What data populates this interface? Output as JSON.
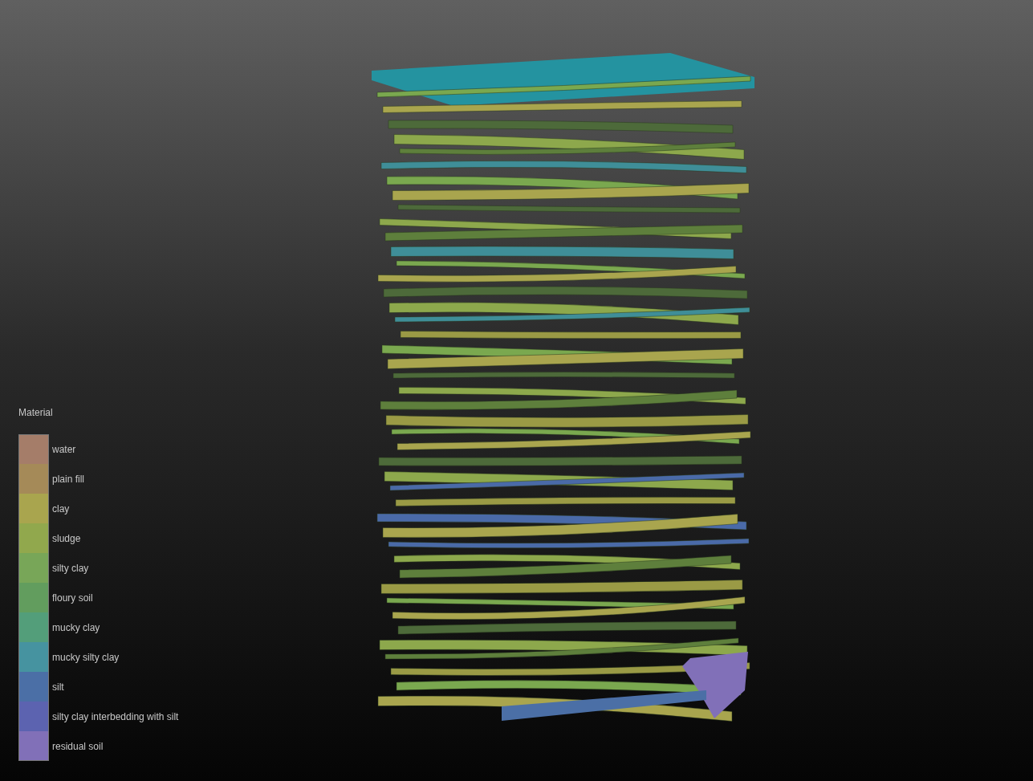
{
  "legend": {
    "title": "Material",
    "items": [
      {
        "label": "water",
        "color": "#a57d69"
      },
      {
        "label": "plain fill",
        "color": "#a58a58"
      },
      {
        "label": "clay",
        "color": "#a9a54e"
      },
      {
        "label": "sludge",
        "color": "#91a84d"
      },
      {
        "label": "silty clay",
        "color": "#78a658"
      },
      {
        "label": "floury soil",
        "color": "#629d5e"
      },
      {
        "label": "mucky clay",
        "color": "#539e7a"
      },
      {
        "label": "mucky silty clay",
        "color": "#4693a0"
      },
      {
        "label": "silt",
        "color": "#4b6fa6"
      },
      {
        "label": "silty clay interbedding with silt",
        "color": "#5c63b0"
      },
      {
        "label": "residual soil",
        "color": "#8170b8"
      }
    ]
  }
}
